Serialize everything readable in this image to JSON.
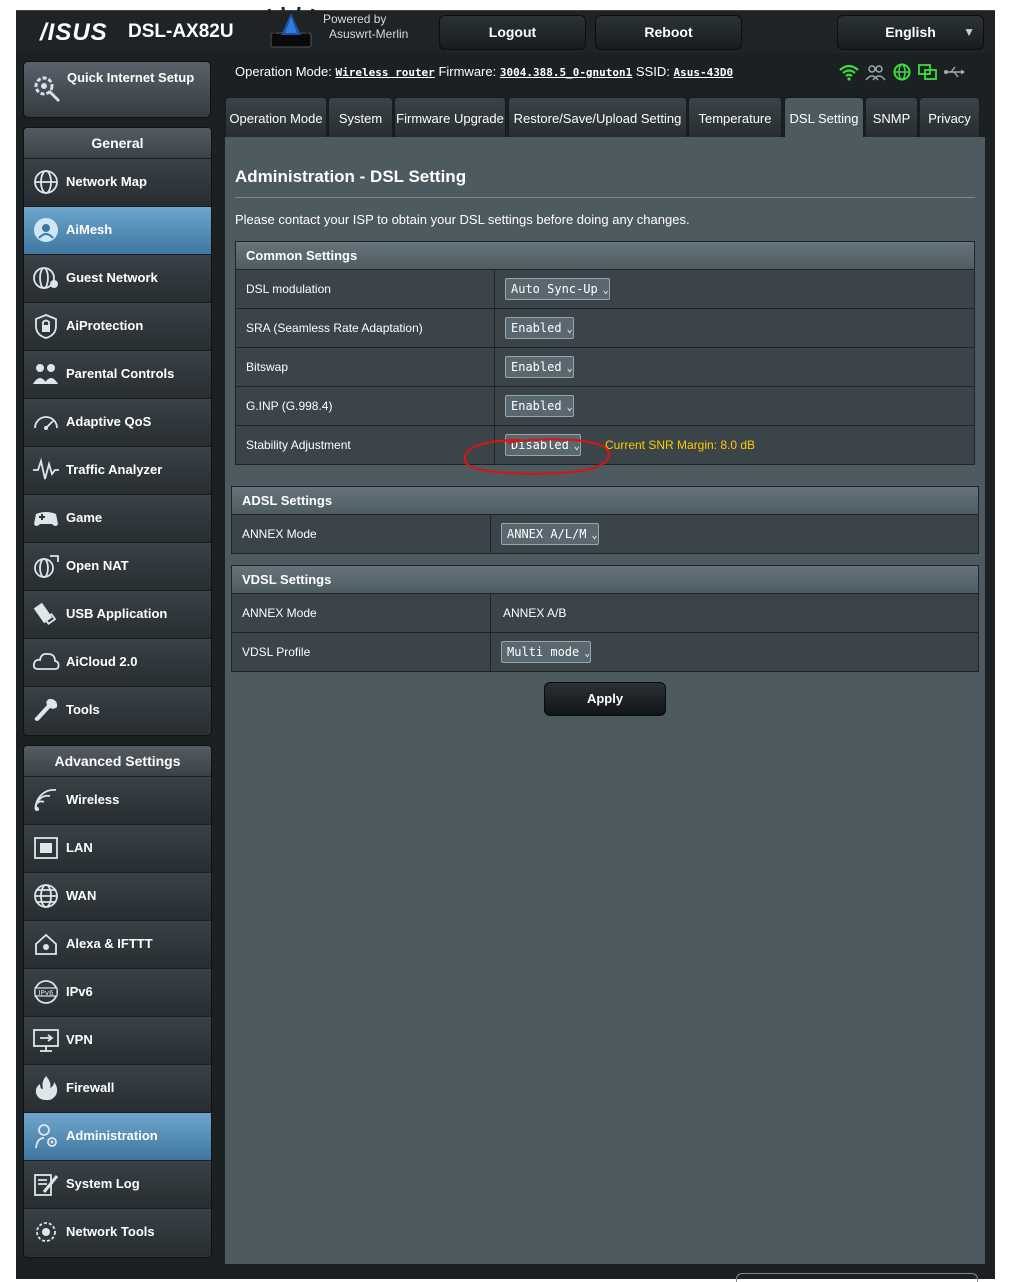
{
  "header": {
    "brand": "/ISUS",
    "model": "DSL-AX82U",
    "powered_by": "Powered by",
    "firmware_name": "Asuswrt-Merlin",
    "logout": "Logout",
    "reboot": "Reboot",
    "language": "English"
  },
  "status": {
    "op_mode_label": "Operation Mode:",
    "op_mode_value": "Wireless router",
    "firmware_label": "Firmware:",
    "firmware_value": "3004.388.5_0-gnuton1",
    "ssid_label": "SSID:",
    "ssid_value": "Asus-43D0"
  },
  "sidebar": {
    "quick_setup": "Quick Internet Setup",
    "general_header": "General",
    "general_items": [
      {
        "label": "Network Map",
        "icon": "globe-network-icon"
      },
      {
        "label": "AiMesh",
        "icon": "aimesh-icon"
      },
      {
        "label": "Guest Network",
        "icon": "guest-globe-icon"
      },
      {
        "label": "AiProtection",
        "icon": "lock-shield-icon"
      },
      {
        "label": "Parental Controls",
        "icon": "family-icon"
      },
      {
        "label": "Adaptive QoS",
        "icon": "gauge-icon"
      },
      {
        "label": "Traffic Analyzer",
        "icon": "waveform-icon"
      },
      {
        "label": "Game",
        "icon": "gamepad-icon"
      },
      {
        "label": "Open NAT",
        "icon": "open-nat-icon"
      },
      {
        "label": "USB Application",
        "icon": "usb-icon"
      },
      {
        "label": "AiCloud 2.0",
        "icon": "cloud-icon"
      },
      {
        "label": "Tools",
        "icon": "wrench-icon"
      }
    ],
    "advanced_header": "Advanced Settings",
    "advanced_items": [
      {
        "label": "Wireless",
        "icon": "wifi-icon"
      },
      {
        "label": "LAN",
        "icon": "lan-port-icon"
      },
      {
        "label": "WAN",
        "icon": "globe-icon"
      },
      {
        "label": "Alexa & IFTTT",
        "icon": "smart-home-icon"
      },
      {
        "label": "IPv6",
        "icon": "ipv6-globe-icon"
      },
      {
        "label": "VPN",
        "icon": "vpn-monitor-icon"
      },
      {
        "label": "Firewall",
        "icon": "fire-icon"
      },
      {
        "label": "Administration",
        "icon": "admin-gear-icon"
      },
      {
        "label": "System Log",
        "icon": "log-pen-icon"
      },
      {
        "label": "Network Tools",
        "icon": "network-gear-icon"
      }
    ]
  },
  "tabs": [
    {
      "label": "Operation Mode"
    },
    {
      "label": "System"
    },
    {
      "label": "Firmware Upgrade"
    },
    {
      "label": "Restore/Save/Upload Setting"
    },
    {
      "label": "Temperature"
    },
    {
      "label": "DSL Setting"
    },
    {
      "label": "SNMP"
    },
    {
      "label": "Privacy"
    }
  ],
  "main": {
    "title": "Administration - DSL Setting",
    "intro": "Please contact your ISP to obtain your DSL settings before doing any changes.",
    "common": {
      "header": "Common Settings",
      "rows": [
        {
          "label": "DSL modulation",
          "value": "Auto Sync-Up"
        },
        {
          "label": "SRA (Seamless Rate Adaptation)",
          "value": "Enabled"
        },
        {
          "label": "Bitswap",
          "value": "Enabled"
        },
        {
          "label": "G.INP (G.998.4)",
          "value": "Enabled"
        },
        {
          "label": "Stability Adjustment",
          "value": "Disabled",
          "note": "Current SNR Margin: 8.0 dB"
        }
      ]
    },
    "adsl": {
      "header": "ADSL Settings",
      "rows": [
        {
          "label": "ANNEX Mode",
          "value": "ANNEX A/L/M"
        }
      ]
    },
    "vdsl": {
      "header": "VDSL Settings",
      "rows": [
        {
          "label": "ANNEX Mode",
          "value": "ANNEX A/B"
        },
        {
          "label": "VDSL Profile",
          "value": "Multi mode"
        }
      ]
    },
    "apply": "Apply"
  },
  "colors": {
    "panel": "#4d5a60",
    "active_menu": "#4f8bb6",
    "note": "#ffcc00",
    "annotation": "#d01818"
  }
}
